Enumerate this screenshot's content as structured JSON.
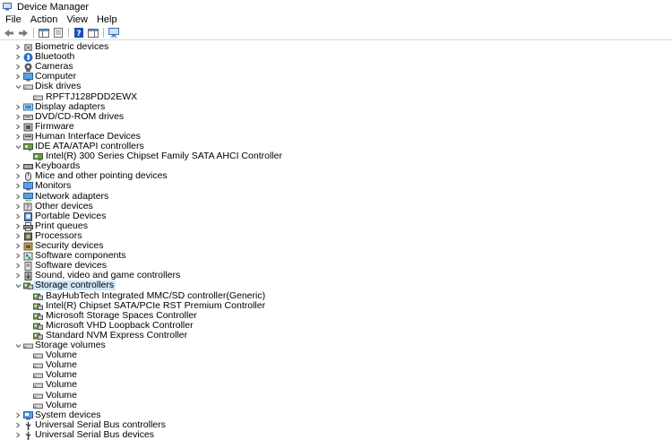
{
  "window": {
    "title": "Device Manager",
    "icon": "device-manager-icon"
  },
  "menu": [
    "File",
    "Action",
    "View",
    "Help"
  ],
  "toolbar": {
    "buttons": [
      "back-arrow-icon",
      "forward-arrow-icon",
      "show-hide-console-tree-icon",
      "properties-icon",
      "help-icon",
      "action-pane-icon",
      "monitor-icon"
    ]
  },
  "colors": {
    "accent_blue": "#1f6fd1",
    "tree_glyph": "#555555",
    "separator": "#d9d9d9"
  },
  "tree": [
    {
      "label": "Biometric devices",
      "icon": "biometric-icon",
      "level": 0,
      "expanded": false
    },
    {
      "label": "Bluetooth",
      "icon": "bluetooth-icon",
      "level": 0,
      "expanded": false
    },
    {
      "label": "Cameras",
      "icon": "camera-icon",
      "level": 0,
      "expanded": false
    },
    {
      "label": "Computer",
      "icon": "computer-icon",
      "level": 0,
      "expanded": false
    },
    {
      "label": "Disk drives",
      "icon": "disk-drive-icon",
      "level": 0,
      "expanded": true
    },
    {
      "label": "RPFTJ128PDD2EWX",
      "icon": "disk-drive-icon",
      "level": 1
    },
    {
      "label": "Display adapters",
      "icon": "display-adapter-icon",
      "level": 0,
      "expanded": false
    },
    {
      "label": "DVD/CD-ROM drives",
      "icon": "dvd-drive-icon",
      "level": 0,
      "expanded": false
    },
    {
      "label": "Firmware",
      "icon": "firmware-icon",
      "level": 0,
      "expanded": false
    },
    {
      "label": "Human Interface Devices",
      "icon": "hid-icon",
      "level": 0,
      "expanded": false
    },
    {
      "label": "IDE ATA/ATAPI controllers",
      "icon": "ide-controller-icon",
      "level": 0,
      "expanded": true
    },
    {
      "label": "Intel(R) 300 Series Chipset Family SATA AHCI Controller",
      "icon": "ide-controller-icon",
      "level": 1
    },
    {
      "label": "Keyboards",
      "icon": "keyboard-icon",
      "level": 0,
      "expanded": false
    },
    {
      "label": "Mice and other pointing devices",
      "icon": "mouse-icon",
      "level": 0,
      "expanded": false
    },
    {
      "label": "Monitors",
      "icon": "monitor-icon",
      "level": 0,
      "expanded": false
    },
    {
      "label": "Network adapters",
      "icon": "network-adapter-icon",
      "level": 0,
      "expanded": false
    },
    {
      "label": "Other devices",
      "icon": "other-devices-icon",
      "level": 0,
      "expanded": false
    },
    {
      "label": "Portable Devices",
      "icon": "portable-device-icon",
      "level": 0,
      "expanded": false
    },
    {
      "label": "Print queues",
      "icon": "printer-icon",
      "level": 0,
      "expanded": false
    },
    {
      "label": "Processors",
      "icon": "processor-icon",
      "level": 0,
      "expanded": false
    },
    {
      "label": "Security devices",
      "icon": "security-device-icon",
      "level": 0,
      "expanded": false
    },
    {
      "label": "Software components",
      "icon": "software-component-icon",
      "level": 0,
      "expanded": false
    },
    {
      "label": "Software devices",
      "icon": "software-device-icon",
      "level": 0,
      "expanded": false
    },
    {
      "label": "Sound, video and game controllers",
      "icon": "sound-icon",
      "level": 0,
      "expanded": false
    },
    {
      "label": "Storage controllers",
      "icon": "storage-controller-icon",
      "level": 0,
      "expanded": true,
      "selected": true
    },
    {
      "label": "BayHubTech Integrated MMC/SD controller(Generic)",
      "icon": "storage-controller-icon",
      "level": 1
    },
    {
      "label": "Intel(R) Chipset SATA/PCIe RST Premium Controller",
      "icon": "storage-controller-icon",
      "level": 1
    },
    {
      "label": "Microsoft Storage Spaces Controller",
      "icon": "storage-controller-icon",
      "level": 1
    },
    {
      "label": "Microsoft VHD Loopback Controller",
      "icon": "storage-controller-icon",
      "level": 1
    },
    {
      "label": "Standard NVM Express Controller",
      "icon": "storage-controller-icon",
      "level": 1
    },
    {
      "label": "Storage volumes",
      "icon": "storage-volume-icon",
      "level": 0,
      "expanded": true
    },
    {
      "label": "Volume",
      "icon": "storage-volume-icon",
      "level": 1
    },
    {
      "label": "Volume",
      "icon": "storage-volume-icon",
      "level": 1
    },
    {
      "label": "Volume",
      "icon": "storage-volume-icon",
      "level": 1
    },
    {
      "label": "Volume",
      "icon": "storage-volume-icon",
      "level": 1
    },
    {
      "label": "Volume",
      "icon": "storage-volume-icon",
      "level": 1
    },
    {
      "label": "Volume",
      "icon": "storage-volume-icon",
      "level": 1
    },
    {
      "label": "System devices",
      "icon": "system-device-icon",
      "level": 0,
      "expanded": false
    },
    {
      "label": "Universal Serial Bus controllers",
      "icon": "usb-icon",
      "level": 0,
      "expanded": false
    },
    {
      "label": "Universal Serial Bus devices",
      "icon": "usb-icon",
      "level": 0,
      "expanded": false
    }
  ]
}
